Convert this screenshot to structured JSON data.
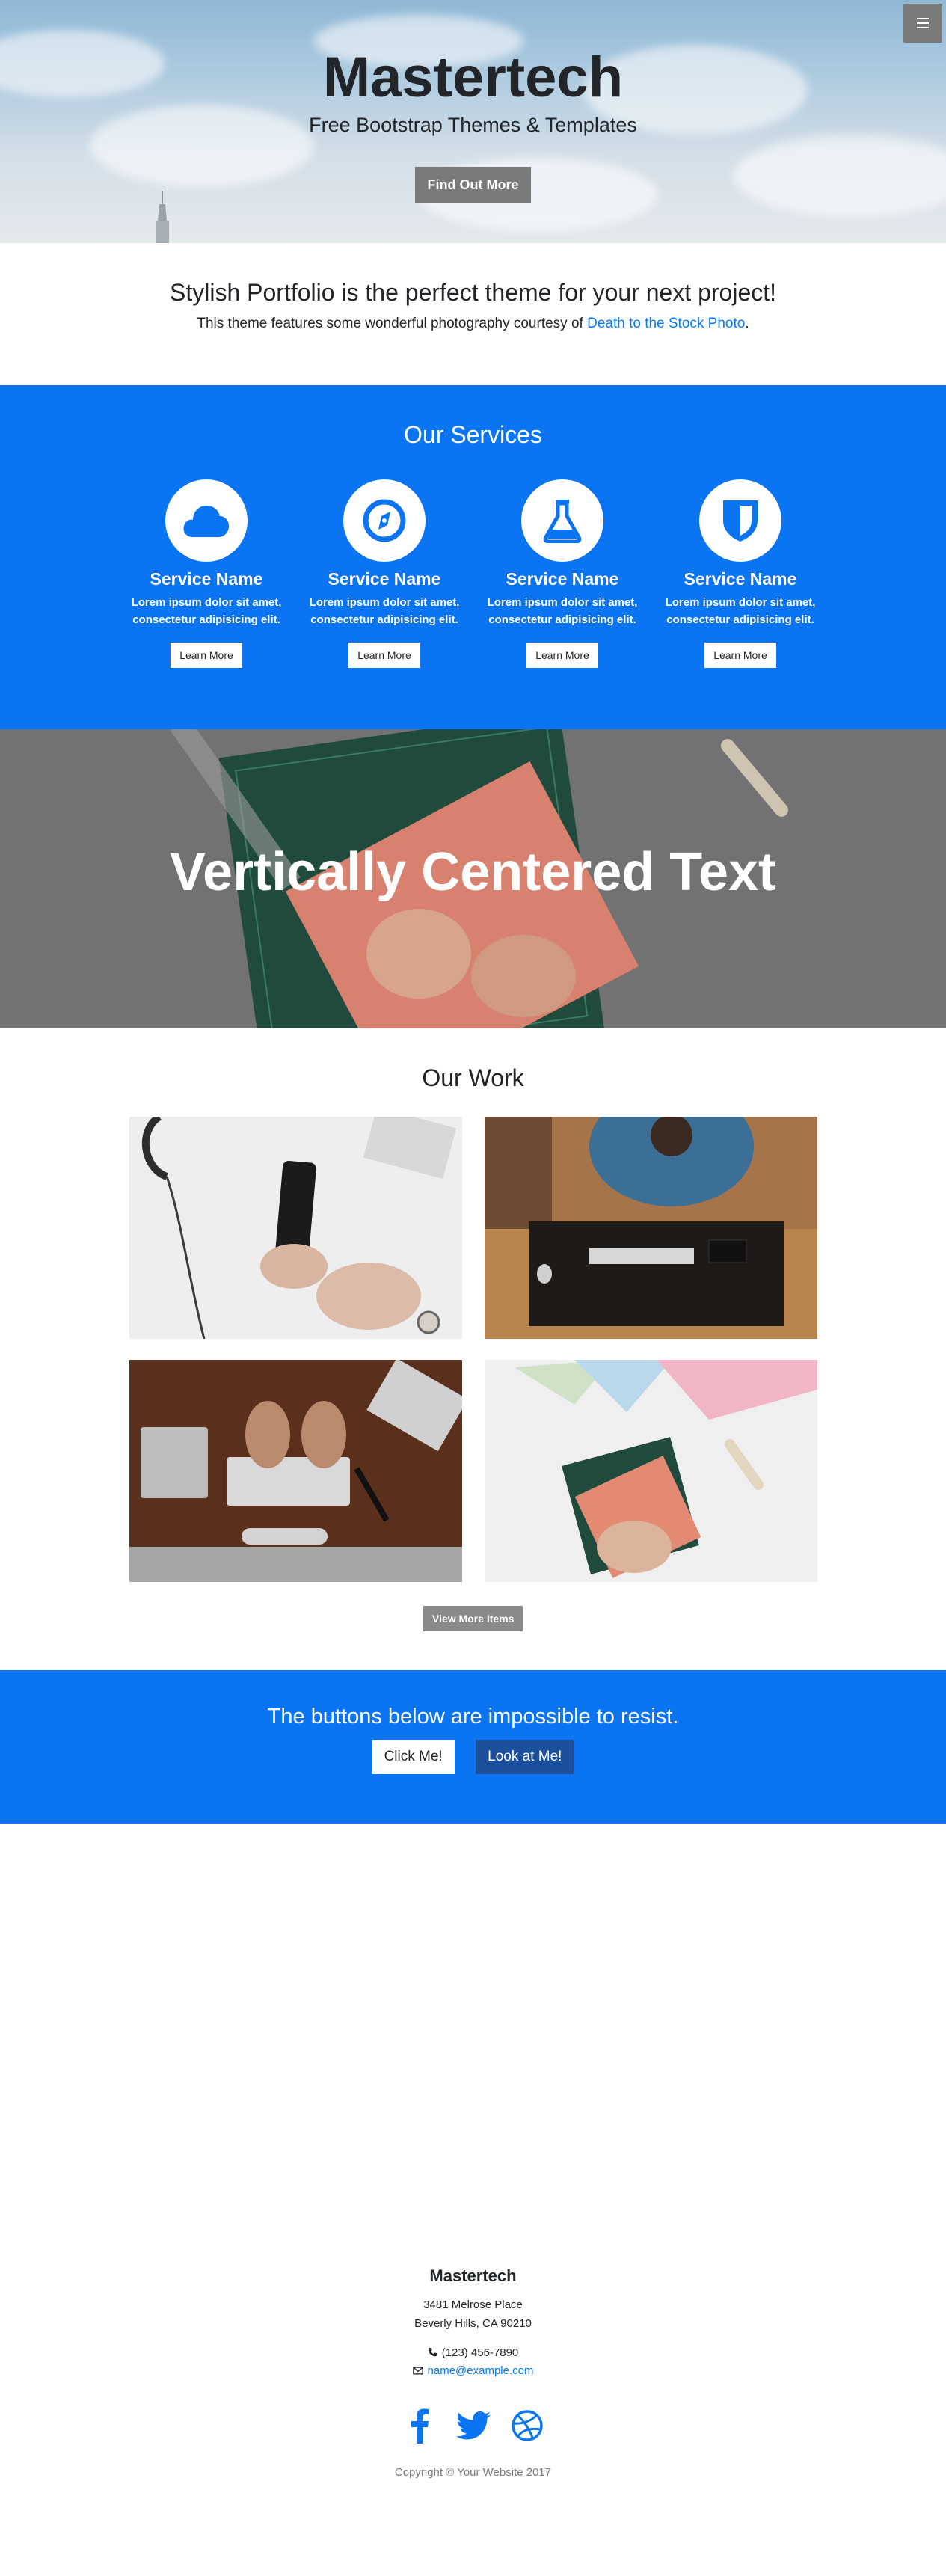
{
  "menu": {
    "icon": "hamburger-menu-icon"
  },
  "hero": {
    "title": "Mastertech",
    "subtitle": "Free Bootstrap Themes & Templates",
    "button": "Find Out More"
  },
  "about": {
    "heading": "Stylish Portfolio is the perfect theme for your next project!",
    "text_before": "This theme features some wonderful photography courtesy of ",
    "link": "Death to the Stock Photo",
    "text_after": "."
  },
  "services": {
    "heading": "Our Services",
    "items": [
      {
        "icon": "cloud-icon",
        "name": "Service Name",
        "desc1": "Lorem ipsum dolor sit amet,",
        "desc2": "consectetur adipisicing elit.",
        "button": "Learn More"
      },
      {
        "icon": "compass-icon",
        "name": "Service Name",
        "desc1": "Lorem ipsum dolor sit amet,",
        "desc2": "consectetur adipisicing elit.",
        "button": "Learn More"
      },
      {
        "icon": "flask-icon",
        "name": "Service Name",
        "desc1": "Lorem ipsum dolor sit amet,",
        "desc2": "consectetur adipisicing elit.",
        "button": "Learn More"
      },
      {
        "icon": "shield-icon",
        "name": "Service Name",
        "desc1": "Lorem ipsum dolor sit amet,",
        "desc2": "consectetur adipisicing elit.",
        "button": "Learn More"
      }
    ]
  },
  "callout": {
    "heading": "Vertically Centered Text"
  },
  "portfolio": {
    "heading": "Our Work",
    "items": [
      "phone-on-desk-photo",
      "man-at-keyboard-photo",
      "hands-typing-photo",
      "paper-and-cutting-mat-photo"
    ],
    "button": "View More Items"
  },
  "cta": {
    "heading": "The buttons below are impossible to resist.",
    "button1": "Click Me!",
    "button2": "Look at Me!"
  },
  "footer": {
    "brand": "Mastertech",
    "address1": "3481 Melrose Place",
    "address2": "Beverly Hills, CA 90210",
    "phone": "(123) 456-7890",
    "email": "name@example.com",
    "social": [
      "facebook-icon",
      "twitter-icon",
      "dribbble-icon"
    ],
    "copyright": "Copyright © Your Website 2017"
  },
  "colors": {
    "primary": "#0a74f2",
    "dark_button": "#1b4f9c",
    "gray_button": "#7a7a7a"
  }
}
